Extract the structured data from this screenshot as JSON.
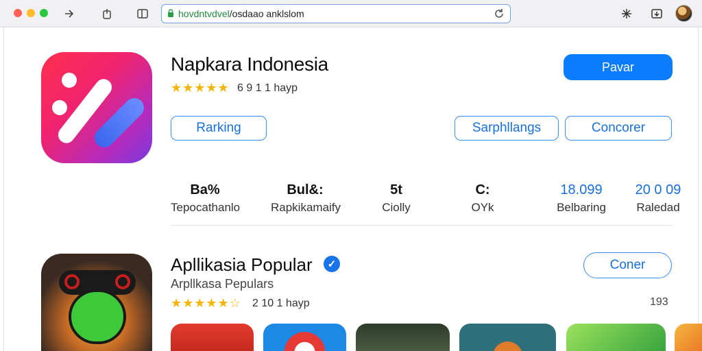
{
  "browser": {
    "url_host": "hovdntvdvel",
    "url_path": "/osdaao anklslom"
  },
  "app": {
    "title": "Napkara Indonesia",
    "stars": "★★★★★",
    "rating_text": "6 9 1   1 hayp",
    "primary_button": "Pavar",
    "ranking_button": "Rarking",
    "secondary_buttons": [
      "Sarphllangs",
      "Concorer"
    ]
  },
  "stats": [
    {
      "value": "Ba%",
      "label": "Tepocathanlo"
    },
    {
      "value": "Bul&:",
      "label": "Rapkikamaify"
    },
    {
      "value": "5t",
      "label": "Ciolly"
    },
    {
      "value": "C:",
      "label": "OYk"
    },
    {
      "value": "18.099",
      "label": "Belbaring"
    },
    {
      "value": "20 0 09",
      "label": "Raledad"
    }
  ],
  "popular": {
    "title": "Apllikasia Popular",
    "subtitle": "Arpllkasa Pepulars",
    "stars": "★★★★★☆",
    "rating_text": "2 10   1 hayp",
    "button": "Coner",
    "count": "193"
  },
  "thumb_colors": [
    "#e23b2e",
    "#1e88e5",
    "#3d4b3a",
    "#2f6f7a",
    "#58b545",
    "#f29a2e"
  ],
  "colors": {
    "accent": "#0a7cff",
    "star": "#f5b400"
  }
}
